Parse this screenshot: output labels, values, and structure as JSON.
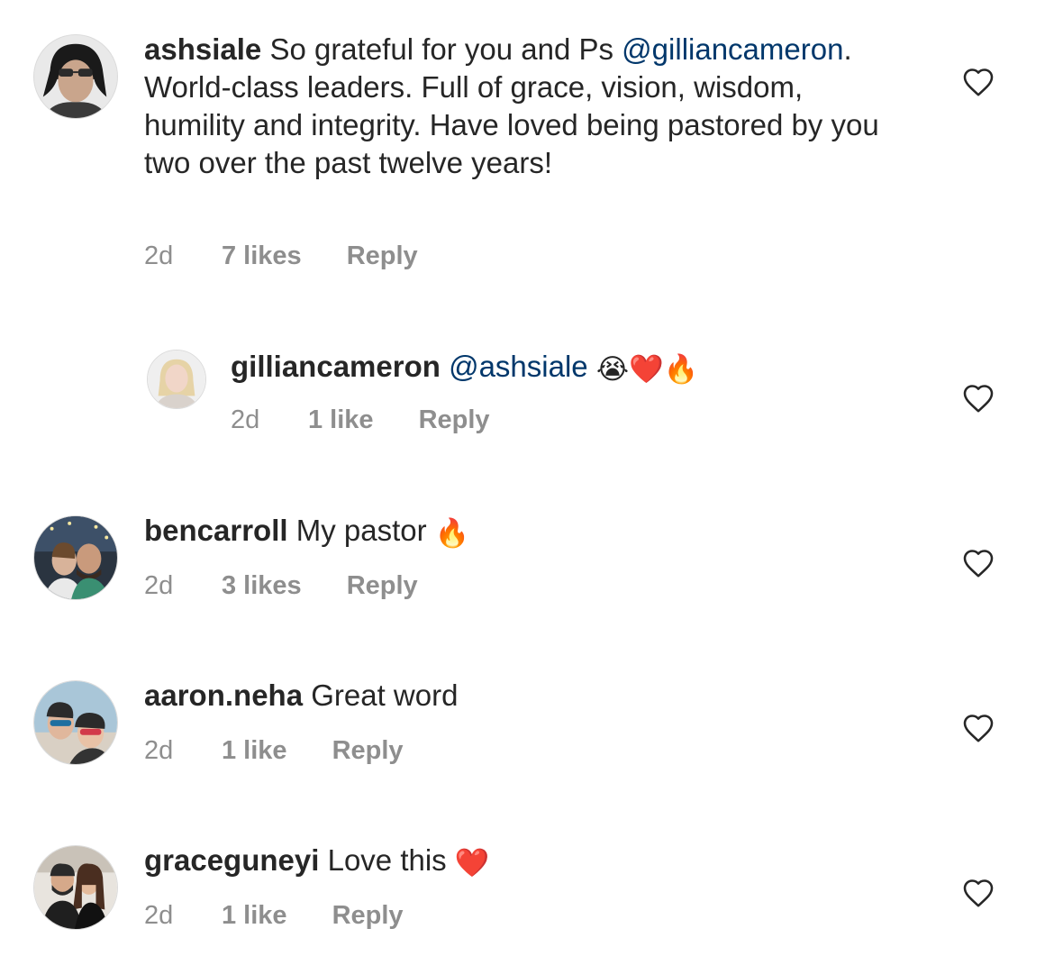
{
  "comments": [
    {
      "username": "ashsiale",
      "text_before": "So grateful for you and Ps",
      "mention": "@gilliancameron",
      "text_after": ". World-class leaders. Full of grace, vision, wisdom, humility and integrity. Have loved being pastored by you two over the past twelve years!",
      "time": "2d",
      "likes": "7 likes",
      "reply": "Reply",
      "emoji": ""
    },
    {
      "username": "gilliancameron",
      "text_before": "",
      "mention": "@ashsiale",
      "text_after": "",
      "emoji": "😭❤️🔥",
      "time": "2d",
      "likes": "1 like",
      "reply": "Reply"
    },
    {
      "username": "bencarroll",
      "text_before": "My pastor",
      "mention": "",
      "text_after": "",
      "emoji": "🔥",
      "time": "2d",
      "likes": "3 likes",
      "reply": "Reply"
    },
    {
      "username": "aaron.neha",
      "text_before": "Great word",
      "mention": "",
      "text_after": "",
      "emoji": "",
      "time": "2d",
      "likes": "1 like",
      "reply": "Reply"
    },
    {
      "username": "graceguneyi",
      "text_before": "Love this",
      "mention": "",
      "text_after": "",
      "emoji": "❤️",
      "time": "2d",
      "likes": "1 like",
      "reply": "Reply"
    }
  ],
  "icons": {
    "like": "heart-outline-icon"
  },
  "colors": {
    "text": "#262626",
    "mention": "#00376b",
    "meta": "#8e8e8e"
  }
}
